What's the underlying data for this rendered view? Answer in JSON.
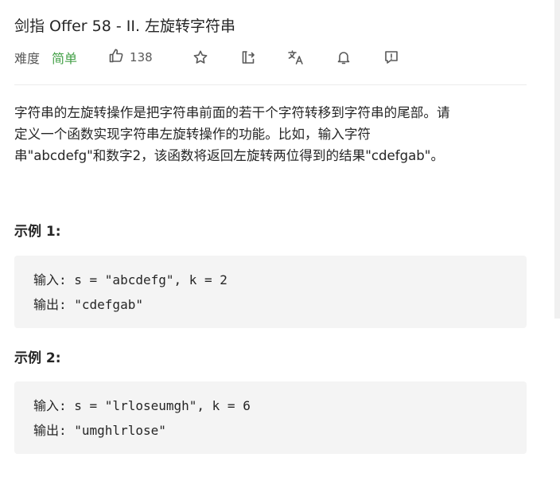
{
  "problem": {
    "title": "剑指 Offer 58 - II. 左旋转字符串",
    "difficulty_label": "难度",
    "difficulty": "简单",
    "likes": "138",
    "difficulty_color": "#43a047"
  },
  "toolbar": {
    "icons": [
      "thumbs-up-icon",
      "star-icon",
      "share-icon",
      "translate-icon",
      "bell-icon",
      "feedback-icon"
    ]
  },
  "description": [
    "字符串的左旋转操作是把字符串前面的若干个字符转移到字符串的尾部。请",
    "定义一个函数实现字符串左旋转操作的功能。比如，输入字符",
    "串\"abcdefg\"和数字2，该函数将返回左旋转两位得到的结果\"cdefgab\"。"
  ],
  "examples": [
    {
      "heading": "示例 1:",
      "input": "输入: s = \"abcdefg\", k = 2",
      "output": "输出: \"cdefgab\""
    },
    {
      "heading": "示例 2:",
      "input": "输入: s = \"lrloseumgh\", k = 6",
      "output": "输出: \"umghlrlose\""
    }
  ]
}
